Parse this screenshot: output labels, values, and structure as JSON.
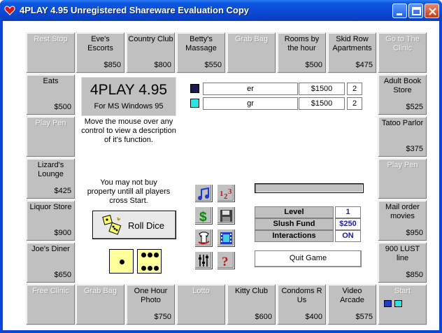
{
  "window": {
    "title": "4PLAY 4.95 Unregistered Shareware Evaluation Copy",
    "icon": "heart-app-icon"
  },
  "board": {
    "top": [
      {
        "name": "Rest Stop",
        "price": "",
        "enabled": false
      },
      {
        "name": "Eve's Escorts",
        "price": "$850",
        "enabled": true
      },
      {
        "name": "Country Club",
        "price": "$800",
        "enabled": true
      },
      {
        "name": "Betty's Massage",
        "price": "$550",
        "enabled": true
      },
      {
        "name": "Grab Bag",
        "price": "",
        "enabled": false
      },
      {
        "name": "Rooms by the hour",
        "price": "$500",
        "enabled": true
      },
      {
        "name": "Skid Row Apartments",
        "price": "$475",
        "enabled": true
      },
      {
        "name": "Go to The Clinic",
        "price": "",
        "enabled": false
      }
    ],
    "left": [
      {
        "name": "Eats",
        "price": "$500",
        "enabled": true
      },
      {
        "name": "Play Pen",
        "price": "",
        "enabled": false
      },
      {
        "name": "Lizard's Lounge",
        "price": "$425",
        "enabled": true
      },
      {
        "name": "Liquor Store",
        "price": "$900",
        "enabled": true
      },
      {
        "name": "Joe's Diner",
        "price": "$650",
        "enabled": true
      }
    ],
    "right": [
      {
        "name": "Adult Book Store",
        "price": "$525",
        "enabled": true
      },
      {
        "name": "Tatoo Parlor",
        "price": "$375",
        "enabled": true
      },
      {
        "name": "Play Pen",
        "price": "",
        "enabled": false
      },
      {
        "name": "Mail order movies",
        "price": "$950",
        "enabled": true
      },
      {
        "name": "900 LUST line",
        "price": "$850",
        "enabled": true
      }
    ],
    "bottom": [
      {
        "name": "Free Clinic",
        "price": "",
        "enabled": false
      },
      {
        "name": "Grab Bag",
        "price": "",
        "enabled": false
      },
      {
        "name": "One Hour Photo",
        "price": "$750",
        "enabled": true
      },
      {
        "name": "Lotto",
        "price": "",
        "enabled": false
      },
      {
        "name": "Kitty Club",
        "price": "$600",
        "enabled": true
      },
      {
        "name": "Condoms R Us",
        "price": "$400",
        "enabled": true
      },
      {
        "name": "Video Arcade",
        "price": "$575",
        "enabled": true
      },
      {
        "name": "Start",
        "price": "",
        "enabled": false
      }
    ]
  },
  "brand": {
    "title": "4PLAY 4.95",
    "subtitle": "For MS Windows 95"
  },
  "help_text": "Move the mouse over any control to view a description of it's function.",
  "notice_text": "You may not buy property untill all players cross Start.",
  "players": [
    {
      "name": "er",
      "money": "$1500",
      "count": "2",
      "color": "#1a1a4e"
    },
    {
      "name": "gr",
      "money": "$1500",
      "count": "2",
      "color": "#26e6e6"
    }
  ],
  "roll_button": {
    "label": "Roll Dice",
    "icon": "dice-cup-icon"
  },
  "dice": [
    1,
    6
  ],
  "tools": [
    {
      "icon": "music-note-icon"
    },
    {
      "icon": "numbers-123-icon"
    },
    {
      "icon": "dollar-icon"
    },
    {
      "icon": "floppy-save-icon"
    },
    {
      "icon": "shirt-swap-icon"
    },
    {
      "icon": "film-strip-icon"
    },
    {
      "icon": "sliders-icon"
    },
    {
      "icon": "question-mark-icon"
    }
  ],
  "stats": {
    "level_label": "Level",
    "level_value": "1",
    "slush_label": "Slush Fund",
    "slush_value": "$250",
    "interactions_label": "Interactions",
    "interactions_value": "ON"
  },
  "quit_button": {
    "label": "Quit Game"
  },
  "start_tokens": [
    "#1a3cc8",
    "#26e6e6"
  ],
  "colors": {
    "title_bar": "#0b46d8",
    "board_cell": "#c0c0c0",
    "die_face": "#ffff99"
  }
}
